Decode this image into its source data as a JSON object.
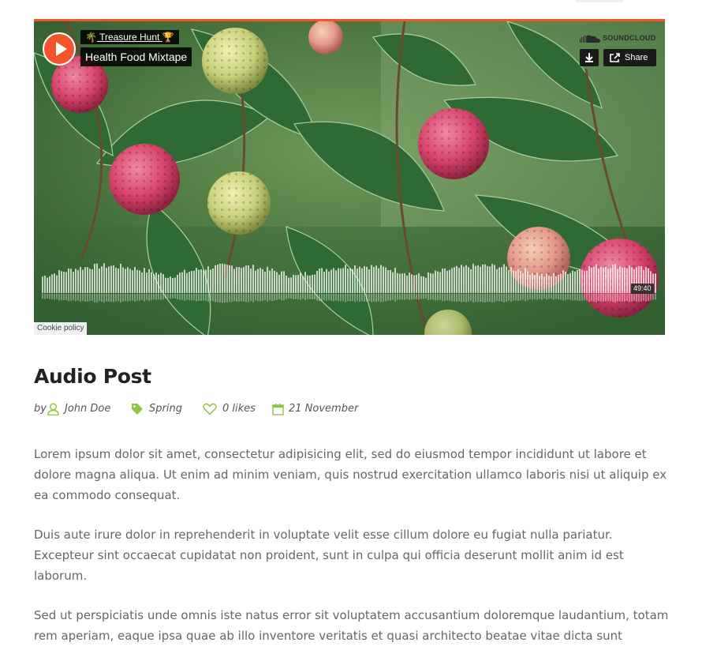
{
  "player": {
    "artist": "Treasure Hunt",
    "track_title": "Health Food Mixtape",
    "logo_text": "SOUNDCLOUD",
    "share_label": "Share",
    "duration": "49:40",
    "cookie_label": "Cookie policy",
    "accent_color": "#f2552c",
    "play_icon": "play-icon",
    "download_icon": "download-icon",
    "share_icon": "share-icon"
  },
  "post": {
    "title": "Audio Post",
    "by_label": "by",
    "author": "John Doe",
    "category": "Spring",
    "likes": "0 likes",
    "date": "21 November",
    "meta_icon_color": "#8dc63f",
    "paragraphs": [
      "Lorem ipsum dolor sit amet, consectetur adipisicing elit, sed do eiusmod tempor incididunt ut labore et dolore magna aliqua. Ut enim ad minim veniam, quis nostrud exercitation ullamco laboris nisi ut aliquip ex ea commodo consequat.",
      "Duis aute irure dolor in reprehenderit in voluptate velit esse cillum dolore eu fugiat nulla pariatur. Excepteur sint occaecat cupidatat non proident, sunt in culpa qui officia deserunt mollit anim id est laborum.",
      "Sed ut perspiciatis unde omnis iste natus error sit voluptatem accusantium doloremque laudantium, totam rem aperiam, eaque ipsa quae ab illo inventore veritatis et quasi architecto beatae vitae dicta sunt"
    ]
  }
}
